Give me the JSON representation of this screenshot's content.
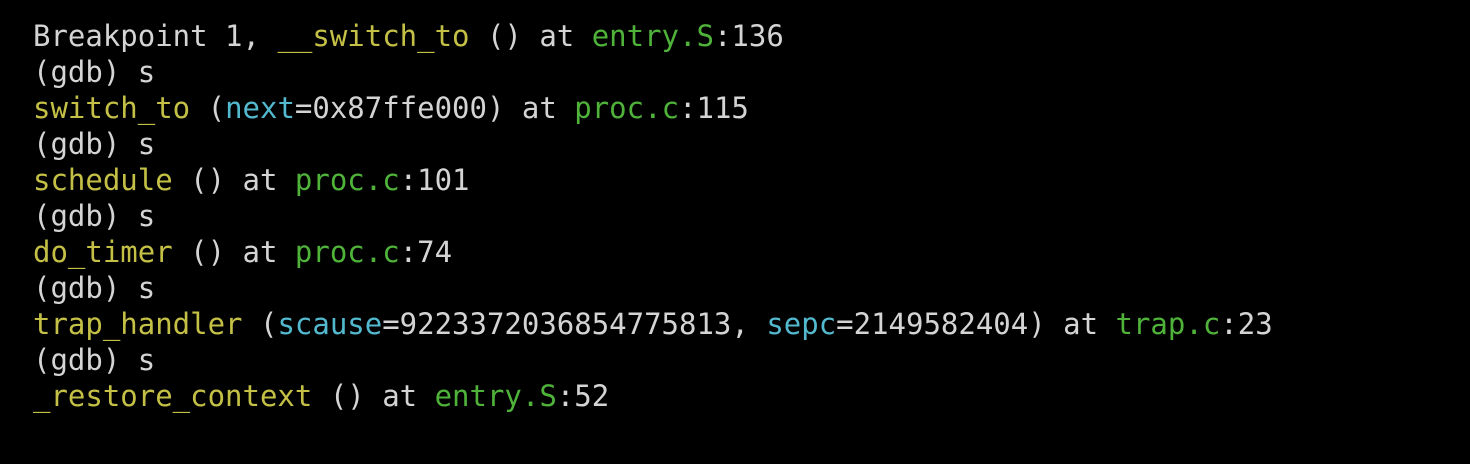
{
  "colors": {
    "background": "#000000",
    "text": "#d4d4d4",
    "function": "#c4c046",
    "file": "#4fb33a",
    "argument": "#53b9cf"
  },
  "terminal": {
    "lines": [
      {
        "segments": [
          {
            "text": "Breakpoint 1, ",
            "kind": "plain"
          },
          {
            "text": "__switch_to",
            "kind": "func"
          },
          {
            "text": " () at ",
            "kind": "plain"
          },
          {
            "text": "entry.S",
            "kind": "file"
          },
          {
            "text": ":136",
            "kind": "plain"
          }
        ]
      },
      {
        "segments": [
          {
            "text": "(gdb) s",
            "kind": "plain"
          }
        ]
      },
      {
        "segments": [
          {
            "text": "switch_to",
            "kind": "func"
          },
          {
            "text": " (",
            "kind": "plain"
          },
          {
            "text": "next",
            "kind": "arg"
          },
          {
            "text": "=0x87ffe000) at ",
            "kind": "plain"
          },
          {
            "text": "proc.c",
            "kind": "file"
          },
          {
            "text": ":115",
            "kind": "plain"
          }
        ]
      },
      {
        "segments": [
          {
            "text": "(gdb) s",
            "kind": "plain"
          }
        ]
      },
      {
        "segments": [
          {
            "text": "schedule",
            "kind": "func"
          },
          {
            "text": " () at ",
            "kind": "plain"
          },
          {
            "text": "proc.c",
            "kind": "file"
          },
          {
            "text": ":101",
            "kind": "plain"
          }
        ]
      },
      {
        "segments": [
          {
            "text": "(gdb) s",
            "kind": "plain"
          }
        ]
      },
      {
        "segments": [
          {
            "text": "do_timer",
            "kind": "func"
          },
          {
            "text": " () at ",
            "kind": "plain"
          },
          {
            "text": "proc.c",
            "kind": "file"
          },
          {
            "text": ":74",
            "kind": "plain"
          }
        ]
      },
      {
        "segments": [
          {
            "text": "(gdb) s",
            "kind": "plain"
          }
        ]
      },
      {
        "segments": [
          {
            "text": "trap_handler",
            "kind": "func"
          },
          {
            "text": " (",
            "kind": "plain"
          },
          {
            "text": "scause",
            "kind": "arg"
          },
          {
            "text": "=9223372036854775813, ",
            "kind": "plain"
          },
          {
            "text": "sepc",
            "kind": "arg"
          },
          {
            "text": "=2149582404) at ",
            "kind": "plain"
          },
          {
            "text": "trap.c",
            "kind": "file"
          },
          {
            "text": ":23",
            "kind": "plain"
          }
        ]
      },
      {
        "segments": [
          {
            "text": "(gdb) s",
            "kind": "plain"
          }
        ]
      },
      {
        "segments": [
          {
            "text": "_restore_context",
            "kind": "func"
          },
          {
            "text": " () at ",
            "kind": "plain"
          },
          {
            "text": "entry.S",
            "kind": "file"
          },
          {
            "text": ":52",
            "kind": "plain"
          }
        ]
      }
    ]
  }
}
